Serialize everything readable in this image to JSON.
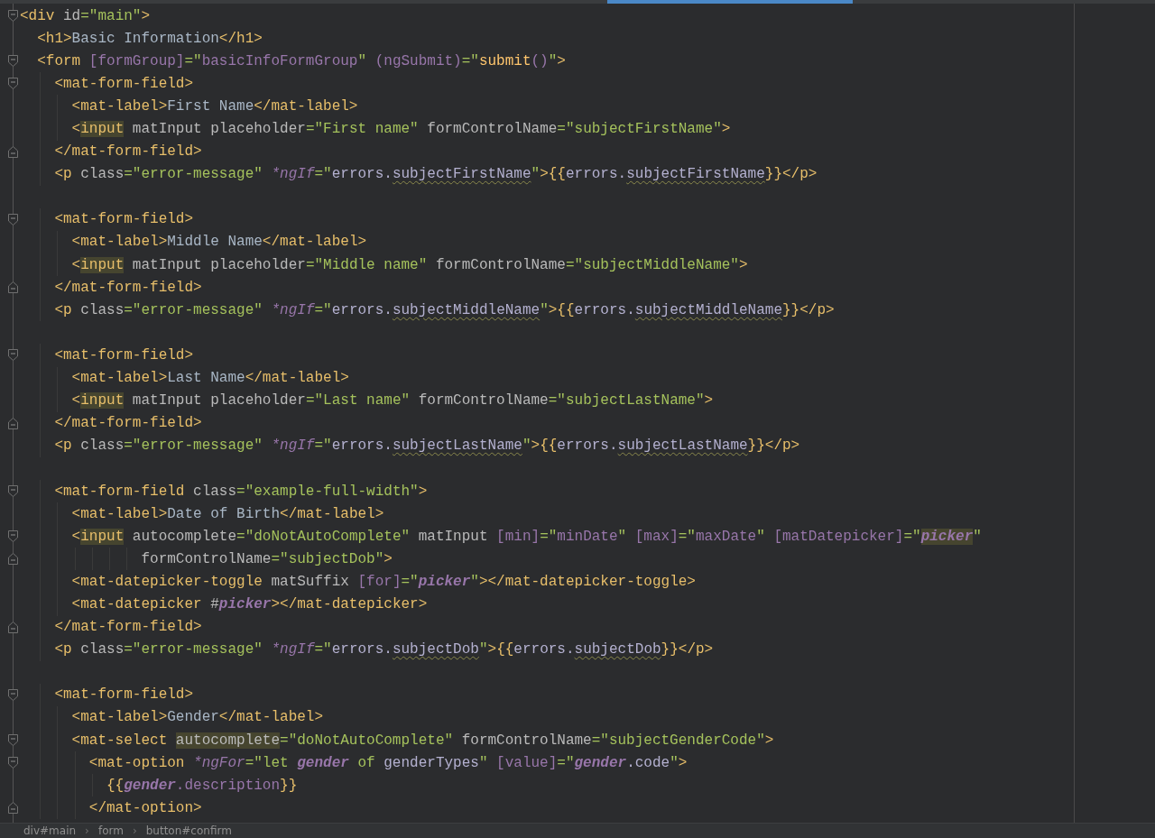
{
  "editor": {
    "lines": [
      {
        "kind": "open",
        "tokens": [
          {
            "text": "<div ",
            "kind": "tag"
          },
          {
            "text": "id",
            "kind": "attr"
          },
          {
            "text": "=\"main\"",
            "kind": "str"
          },
          {
            "text": ">",
            "kind": "tag"
          }
        ]
      },
      {
        "kind": "plain",
        "tokens": [
          {
            "text": "  <h1>",
            "kind": "tag"
          },
          {
            "text": "Basic Information",
            "kind": "text"
          },
          {
            "text": "</h1>",
            "kind": "tag"
          }
        ]
      },
      {
        "kind": "open",
        "tokens": [
          {
            "text": "  <form ",
            "kind": "tag"
          },
          {
            "text": "[formGroup]",
            "kind": "prop"
          },
          {
            "text": "=\"",
            "kind": "str"
          },
          {
            "text": "basicInfoFormGroup",
            "kind": "prop"
          },
          {
            "text": "\" ",
            "kind": "str"
          },
          {
            "text": "(ngSubmit)",
            "kind": "prop"
          },
          {
            "text": "=\"",
            "kind": "str"
          },
          {
            "text": "submit",
            "kind": "fn"
          },
          {
            "text": "()",
            "kind": "prop"
          },
          {
            "text": "\"",
            "kind": "str"
          },
          {
            "text": ">",
            "kind": "tag"
          }
        ]
      },
      {
        "kind": "open",
        "tokens": [
          {
            "text": "    <mat-form-field>",
            "kind": "tag"
          }
        ]
      },
      {
        "kind": "plain",
        "tokens": [
          {
            "text": "      <mat-label>",
            "kind": "tag"
          },
          {
            "text": "First Name",
            "kind": "text"
          },
          {
            "text": "</mat-label>",
            "kind": "tag"
          }
        ]
      },
      {
        "kind": "plain",
        "tokens": [
          {
            "text": "      <",
            "kind": "tag"
          },
          {
            "text": "input",
            "kind": "tag",
            "highlight": true
          },
          {
            "text": " matInput placeholder",
            "kind": "attr"
          },
          {
            "text": "=\"First name\"",
            "kind": "str"
          },
          {
            "text": " formControlName",
            "kind": "attr"
          },
          {
            "text": "=\"subjectFirstName\"",
            "kind": "str"
          },
          {
            "text": ">",
            "kind": "tag"
          }
        ]
      },
      {
        "kind": "close",
        "tokens": [
          {
            "text": "    </mat-form-field>",
            "kind": "tag"
          }
        ]
      },
      {
        "kind": "plain",
        "tokens": [
          {
            "text": "    <p ",
            "kind": "tag"
          },
          {
            "text": "class",
            "kind": "attr"
          },
          {
            "text": "=\"error-message\" ",
            "kind": "str"
          },
          {
            "text": "*ngIf",
            "kind": "ital"
          },
          {
            "text": "=\"",
            "kind": "str"
          },
          {
            "text": "errors.",
            "kind": "expr"
          },
          {
            "text": "subjectFirstName",
            "kind": "expr",
            "squiggle": true
          },
          {
            "text": "\"",
            "kind": "str"
          },
          {
            "text": ">{{",
            "kind": "tag"
          },
          {
            "text": "errors.",
            "kind": "expr"
          },
          {
            "text": "subjectFirstName",
            "kind": "expr",
            "squiggle": true
          },
          {
            "text": "}}</p>",
            "kind": "tag"
          }
        ]
      },
      {
        "kind": "blank"
      },
      {
        "kind": "open",
        "tokens": [
          {
            "text": "    <mat-form-field>",
            "kind": "tag"
          }
        ]
      },
      {
        "kind": "plain",
        "tokens": [
          {
            "text": "      <mat-label>",
            "kind": "tag"
          },
          {
            "text": "Middle Name",
            "kind": "text"
          },
          {
            "text": "</mat-label>",
            "kind": "tag"
          }
        ]
      },
      {
        "kind": "plain",
        "tokens": [
          {
            "text": "      <",
            "kind": "tag"
          },
          {
            "text": "input",
            "kind": "tag",
            "highlight": true
          },
          {
            "text": " matInput placeholder",
            "kind": "attr"
          },
          {
            "text": "=\"Middle name\"",
            "kind": "str"
          },
          {
            "text": " formControlName",
            "kind": "attr"
          },
          {
            "text": "=\"subjectMiddleName\"",
            "kind": "str"
          },
          {
            "text": ">",
            "kind": "tag"
          }
        ]
      },
      {
        "kind": "close",
        "tokens": [
          {
            "text": "    </mat-form-field>",
            "kind": "tag"
          }
        ]
      },
      {
        "kind": "plain",
        "tokens": [
          {
            "text": "    <p ",
            "kind": "tag"
          },
          {
            "text": "class",
            "kind": "attr"
          },
          {
            "text": "=\"error-message\" ",
            "kind": "str"
          },
          {
            "text": "*ngIf",
            "kind": "ital"
          },
          {
            "text": "=\"",
            "kind": "str"
          },
          {
            "text": "errors.",
            "kind": "expr"
          },
          {
            "text": "subjectMiddleName",
            "kind": "expr",
            "squiggle": true
          },
          {
            "text": "\"",
            "kind": "str"
          },
          {
            "text": ">{{",
            "kind": "tag"
          },
          {
            "text": "errors.",
            "kind": "expr"
          },
          {
            "text": "subjectMiddleName",
            "kind": "expr",
            "squiggle": true
          },
          {
            "text": "}}</p>",
            "kind": "tag"
          }
        ]
      },
      {
        "kind": "blank"
      },
      {
        "kind": "open",
        "tokens": [
          {
            "text": "    <mat-form-field>",
            "kind": "tag"
          }
        ]
      },
      {
        "kind": "plain",
        "tokens": [
          {
            "text": "      <mat-label>",
            "kind": "tag"
          },
          {
            "text": "Last Name",
            "kind": "text"
          },
          {
            "text": "</mat-label>",
            "kind": "tag"
          }
        ]
      },
      {
        "kind": "plain",
        "tokens": [
          {
            "text": "      <",
            "kind": "tag"
          },
          {
            "text": "input",
            "kind": "tag",
            "highlight": true
          },
          {
            "text": " matInput placeholder",
            "kind": "attr"
          },
          {
            "text": "=\"Last name\"",
            "kind": "str"
          },
          {
            "text": " formControlName",
            "kind": "attr"
          },
          {
            "text": "=\"subjectLastName\"",
            "kind": "str"
          },
          {
            "text": ">",
            "kind": "tag"
          }
        ]
      },
      {
        "kind": "close",
        "tokens": [
          {
            "text": "    </mat-form-field>",
            "kind": "tag"
          }
        ]
      },
      {
        "kind": "plain",
        "tokens": [
          {
            "text": "    <p ",
            "kind": "tag"
          },
          {
            "text": "class",
            "kind": "attr"
          },
          {
            "text": "=\"error-message\" ",
            "kind": "str"
          },
          {
            "text": "*ngIf",
            "kind": "ital"
          },
          {
            "text": "=\"",
            "kind": "str"
          },
          {
            "text": "errors.",
            "kind": "expr"
          },
          {
            "text": "subjectLastName",
            "kind": "expr",
            "squiggle": true
          },
          {
            "text": "\"",
            "kind": "str"
          },
          {
            "text": ">{{",
            "kind": "tag"
          },
          {
            "text": "errors.",
            "kind": "expr"
          },
          {
            "text": "subjectLastName",
            "kind": "expr",
            "squiggle": true
          },
          {
            "text": "}}</p>",
            "kind": "tag"
          }
        ]
      },
      {
        "kind": "blank"
      },
      {
        "kind": "open",
        "tokens": [
          {
            "text": "    <mat-form-field ",
            "kind": "tag"
          },
          {
            "text": "class",
            "kind": "attr"
          },
          {
            "text": "=\"example-full-width\"",
            "kind": "str"
          },
          {
            "text": ">",
            "kind": "tag"
          }
        ]
      },
      {
        "kind": "plain",
        "tokens": [
          {
            "text": "      <mat-label>",
            "kind": "tag"
          },
          {
            "text": "Date of Birth",
            "kind": "text"
          },
          {
            "text": "</mat-label>",
            "kind": "tag"
          }
        ]
      },
      {
        "kind": "open",
        "tokens": [
          {
            "text": "      <",
            "kind": "tag"
          },
          {
            "text": "input",
            "kind": "tag",
            "highlight": true
          },
          {
            "text": " autocomplete",
            "kind": "attr"
          },
          {
            "text": "=\"doNotAutoComplete\"",
            "kind": "str"
          },
          {
            "text": " matInput ",
            "kind": "attr"
          },
          {
            "text": "[min]",
            "kind": "prop"
          },
          {
            "text": "=\"",
            "kind": "str"
          },
          {
            "text": "minDate",
            "kind": "prop"
          },
          {
            "text": "\" ",
            "kind": "str"
          },
          {
            "text": "[max]",
            "kind": "prop"
          },
          {
            "text": "=\"",
            "kind": "str"
          },
          {
            "text": "maxDate",
            "kind": "prop"
          },
          {
            "text": "\" ",
            "kind": "str"
          },
          {
            "text": "[matDatepicker]",
            "kind": "prop"
          },
          {
            "text": "=\"",
            "kind": "str"
          },
          {
            "text": "picker",
            "kind": "ivar",
            "highlight": true
          },
          {
            "text": "\"",
            "kind": "str"
          }
        ]
      },
      {
        "kind": "close",
        "tokens": [
          {
            "text": "              formControlName",
            "kind": "attr"
          },
          {
            "text": "=\"subjectDob\"",
            "kind": "str"
          },
          {
            "text": ">",
            "kind": "tag"
          }
        ]
      },
      {
        "kind": "plain",
        "tokens": [
          {
            "text": "      <mat-datepicker-toggle ",
            "kind": "tag"
          },
          {
            "text": "matSuffix ",
            "kind": "attr"
          },
          {
            "text": "[for]",
            "kind": "prop"
          },
          {
            "text": "=\"",
            "kind": "str"
          },
          {
            "text": "picker",
            "kind": "ivar"
          },
          {
            "text": "\"",
            "kind": "str"
          },
          {
            "text": "></mat-datepicker-toggle>",
            "kind": "tag"
          }
        ]
      },
      {
        "kind": "plain",
        "tokens": [
          {
            "text": "      <mat-datepicker ",
            "kind": "tag"
          },
          {
            "text": "#",
            "kind": "attr"
          },
          {
            "text": "picker",
            "kind": "ivar"
          },
          {
            "text": "></mat-datepicker>",
            "kind": "tag"
          }
        ]
      },
      {
        "kind": "close",
        "tokens": [
          {
            "text": "    </mat-form-field>",
            "kind": "tag"
          }
        ]
      },
      {
        "kind": "plain",
        "tokens": [
          {
            "text": "    <p ",
            "kind": "tag"
          },
          {
            "text": "class",
            "kind": "attr"
          },
          {
            "text": "=\"error-message\" ",
            "kind": "str"
          },
          {
            "text": "*ngIf",
            "kind": "ital"
          },
          {
            "text": "=\"",
            "kind": "str"
          },
          {
            "text": "errors.",
            "kind": "expr"
          },
          {
            "text": "subjectDob",
            "kind": "expr",
            "squiggle": true
          },
          {
            "text": "\"",
            "kind": "str"
          },
          {
            "text": ">{{",
            "kind": "tag"
          },
          {
            "text": "errors.",
            "kind": "expr"
          },
          {
            "text": "subjectDob",
            "kind": "expr",
            "squiggle": true
          },
          {
            "text": "}}</p>",
            "kind": "tag"
          }
        ]
      },
      {
        "kind": "blank"
      },
      {
        "kind": "open",
        "tokens": [
          {
            "text": "    <mat-form-field>",
            "kind": "tag"
          }
        ]
      },
      {
        "kind": "plain",
        "tokens": [
          {
            "text": "      <mat-label>",
            "kind": "tag"
          },
          {
            "text": "Gender",
            "kind": "text"
          },
          {
            "text": "</mat-label>",
            "kind": "tag"
          }
        ]
      },
      {
        "kind": "open",
        "tokens": [
          {
            "text": "      <mat-select ",
            "kind": "tag"
          },
          {
            "text": "autocomplete",
            "kind": "attr",
            "highlight": true
          },
          {
            "text": "=\"doNotAutoComplete\"",
            "kind": "str"
          },
          {
            "text": " formControlName",
            "kind": "attr"
          },
          {
            "text": "=\"subjectGenderCode\"",
            "kind": "str"
          },
          {
            "text": ">",
            "kind": "tag"
          }
        ]
      },
      {
        "kind": "open",
        "tokens": [
          {
            "text": "        <mat-option ",
            "kind": "tag"
          },
          {
            "text": "*ngFor",
            "kind": "ital"
          },
          {
            "text": "=\"let ",
            "kind": "str"
          },
          {
            "text": "gender",
            "kind": "ivar"
          },
          {
            "text": " of ",
            "kind": "str"
          },
          {
            "text": "genderTypes",
            "kind": "expr"
          },
          {
            "text": "\" ",
            "kind": "str"
          },
          {
            "text": "[value]",
            "kind": "prop"
          },
          {
            "text": "=\"",
            "kind": "str"
          },
          {
            "text": "gender",
            "kind": "ivar"
          },
          {
            "text": ".code",
            "kind": "expr"
          },
          {
            "text": "\"",
            "kind": "str"
          },
          {
            "text": ">",
            "kind": "tag"
          }
        ]
      },
      {
        "kind": "plain",
        "tokens": [
          {
            "text": "          {{",
            "kind": "tag"
          },
          {
            "text": "gender",
            "kind": "ivar"
          },
          {
            "text": ".description",
            "kind": "prop"
          },
          {
            "text": "}}",
            "kind": "tag"
          }
        ]
      },
      {
        "kind": "close",
        "tokens": [
          {
            "text": "        </mat-option>",
            "kind": "tag"
          }
        ]
      }
    ]
  },
  "breadcrumb": {
    "separator": "›",
    "items": [
      "div#main",
      "form",
      "button#confirm"
    ]
  }
}
